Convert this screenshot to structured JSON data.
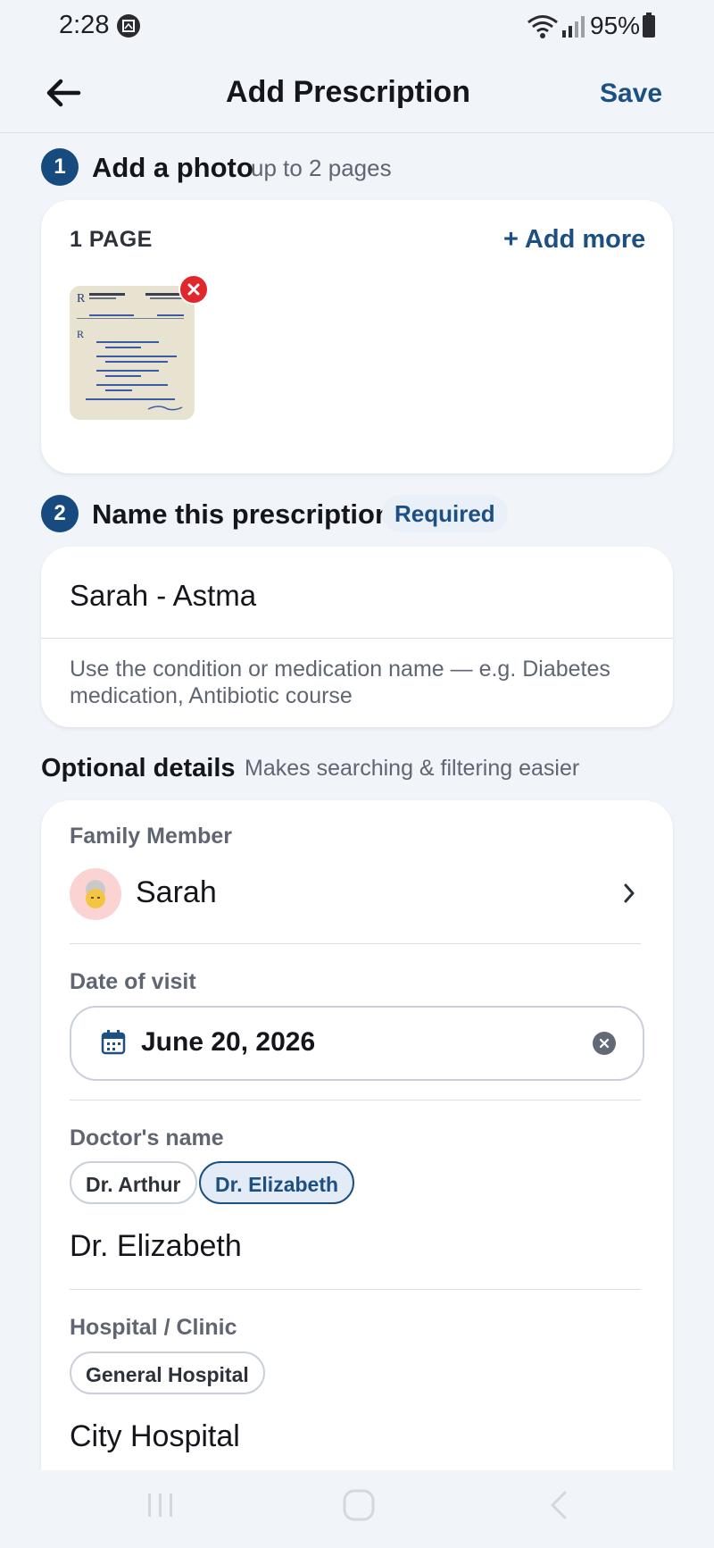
{
  "status_bar": {
    "time": "2:28",
    "battery": "95%",
    "icons": [
      "image-notification-icon",
      "wifi-icon",
      "signal-icon",
      "battery-icon"
    ]
  },
  "app_bar": {
    "back_icon": "arrow-left-icon",
    "title": "Add Prescription",
    "save_label": "Save"
  },
  "step1": {
    "number": "1",
    "title": "Add a photo",
    "subtitle": "up to 2 pages",
    "page_count": "1 PAGE",
    "add_more_label": "+ Add more"
  },
  "step2": {
    "number": "2",
    "title": "Name this prescription",
    "required_label": "Required",
    "name_value": "Sarah - Astma",
    "help_text": "Use the condition or medication name — e.g. Diabetes medication, Antibiotic course"
  },
  "optional": {
    "title": "Optional details",
    "subtitle": "Makes searching & filtering easier",
    "family_member": {
      "label": "Family Member",
      "value": "Sarah",
      "avatar": "elderly-person-avatar"
    },
    "date": {
      "label": "Date of visit",
      "value": "June 20, 2026"
    },
    "doctor": {
      "label": "Doctor's name",
      "chips": [
        "Dr. Arthur",
        "Dr. Elizabeth"
      ],
      "selected": "Dr. Elizabeth",
      "value": "Dr. Elizabeth"
    },
    "hospital": {
      "label": "Hospital / Clinic",
      "chips": [
        "General Hospital"
      ],
      "value": "City Hospital"
    }
  },
  "colors": {
    "accent": "#1c4f82",
    "badge": "#174a7e",
    "danger": "#e1262c",
    "background": "#f1f4f9"
  }
}
